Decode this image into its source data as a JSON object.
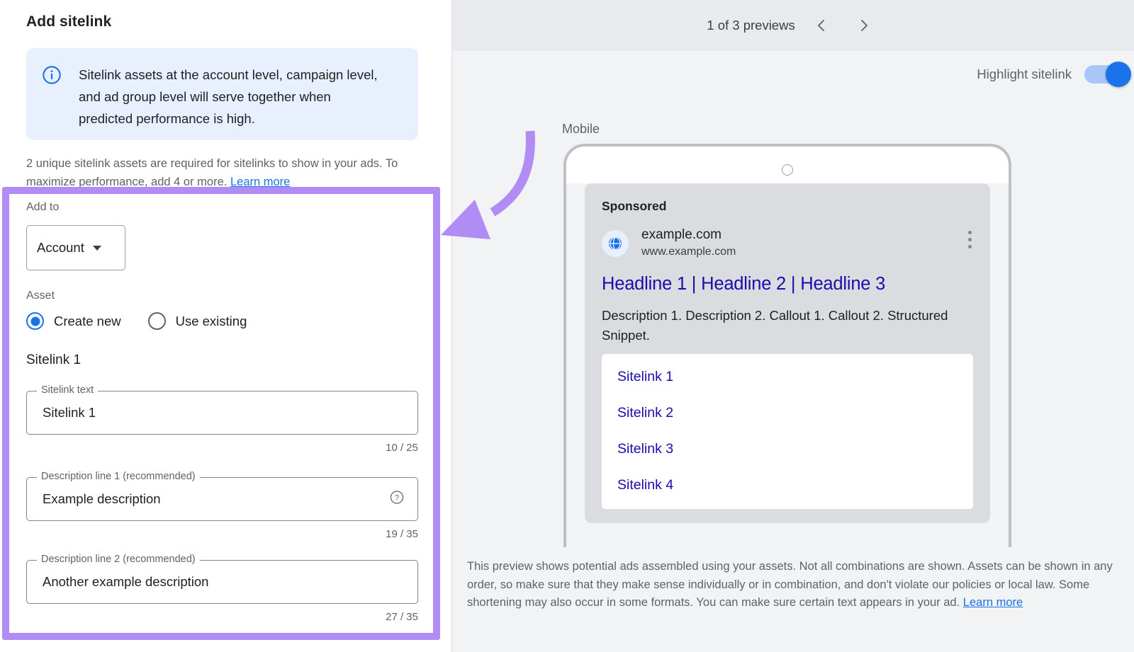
{
  "left": {
    "title": "Add sitelink",
    "info_banner": {
      "icon": "info-icon",
      "text": "Sitelink assets at the account level, campaign level, and ad group level will serve together when predicted performance is high."
    },
    "helper_text": "2 unique sitelink assets are required for sitelinks to show in your ads. To maximize performance, add 4 or more.",
    "helper_link": "Learn more",
    "add_to": {
      "label": "Add to",
      "selected": "Account"
    },
    "asset": {
      "label": "Asset",
      "options": [
        "Create new",
        "Use existing"
      ],
      "selected": "Create new"
    },
    "sitelink_section_title": "Sitelink 1",
    "fields": [
      {
        "legend": "Sitelink text",
        "value": "Sitelink 1",
        "counter": "10 / 25",
        "help": false
      },
      {
        "legend": "Description line 1 (recommended)",
        "value": "Example description",
        "counter": "19 / 35",
        "help": true
      },
      {
        "legend": "Description line 2 (recommended)",
        "value": "Another example description",
        "counter": "27 / 35",
        "help": false
      }
    ]
  },
  "right": {
    "preview_count": "1 of 3 previews",
    "prev_icon": "chevron-left-icon",
    "next_icon": "chevron-right-icon",
    "highlight_label": "Highlight sitelink",
    "highlight_on": true,
    "device_label": "Mobile",
    "ad": {
      "sponsored": "Sponsored",
      "site_name": "example.com",
      "site_url": "www.example.com",
      "headline": "Headline 1 | Headline 2 | Headline 3",
      "description": "Description 1. Description 2. Callout 1. Callout 2. Structured Snippet.",
      "sitelinks": [
        "Sitelink 1",
        "Sitelink 2",
        "Sitelink 3",
        "Sitelink 4"
      ]
    },
    "footnote": "This preview shows potential ads assembled using your assets. Not all combinations are shown. Assets can be shown in any order, so make sure that they make sense individually or in combination, and don't violate our policies or local law. Some shortening may also occur in some formats. You can make sure certain text appears in your ad.",
    "footnote_link": "Learn more"
  },
  "annotation": {
    "highlight_color": "#b18cf5",
    "arrow_color": "#b18cf5"
  },
  "colors": {
    "accent_blue": "#1a73e8",
    "link_blue": "#1a0dab",
    "info_bg": "#e8f0fe",
    "panel_bg": "#f1f3f4"
  }
}
